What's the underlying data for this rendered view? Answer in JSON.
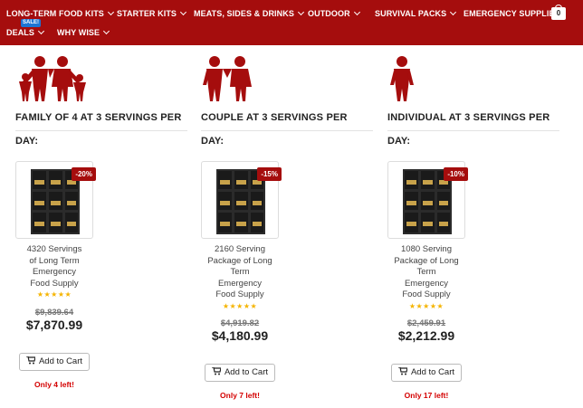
{
  "nav": {
    "items": [
      {
        "label": "LONG-TERM FOOD KITS"
      },
      {
        "label": "STARTER KITS"
      },
      {
        "label": "MEATS, SIDES & DRINKS"
      },
      {
        "label": "OUTDOOR"
      },
      {
        "label": "SURVIVAL PACKS"
      },
      {
        "label": "EMERGENCY SUPPLIES"
      },
      {
        "label": "DEALS"
      },
      {
        "label": "WHY WISE"
      }
    ],
    "sale_badge": "SALE!",
    "cart_count": "0"
  },
  "colors": {
    "brand": "#a50d0d",
    "sale_badge": "#1d75d4",
    "stars": "#f5b400",
    "stock_alert": "#d40000"
  },
  "products": [
    {
      "group_icon": "family-of-four-icon",
      "heading_line1": "FAMILY OF 4 AT 3 SERVINGS PER",
      "heading_line2": "DAY:",
      "discount": "-20%",
      "name": [
        "4320 Servings",
        "of Long Term",
        "Emergency",
        "Food Supply"
      ],
      "rating": "★★★★★",
      "old_price": "$9,839.64",
      "price": "$7,870.99",
      "button": "Add to Cart",
      "stock": "Only 4 left!"
    },
    {
      "group_icon": "couple-icon",
      "heading_line1": "COUPLE AT 3 SERVINGS PER",
      "heading_line2": "DAY:",
      "discount": "-15%",
      "name": [
        "2160 Serving",
        "Package of Long",
        "Term",
        "Emergency",
        "Food Supply"
      ],
      "rating": "★★★★★",
      "old_price": "$4,919.82",
      "price": "$4,180.99",
      "button": "Add to Cart",
      "stock": "Only 7 left!"
    },
    {
      "group_icon": "individual-icon",
      "heading_line1": "INDIVIDUAL AT 3 SERVINGS PER",
      "heading_line2": "DAY:",
      "discount": "-10%",
      "name": [
        "1080 Serving",
        "Package of Long",
        "Term",
        "Emergency",
        "Food Supply"
      ],
      "rating": "★★★★★",
      "old_price": "$2,459.91",
      "price": "$2,212.99",
      "button": "Add to Cart",
      "stock": "Only 17 left!"
    }
  ]
}
